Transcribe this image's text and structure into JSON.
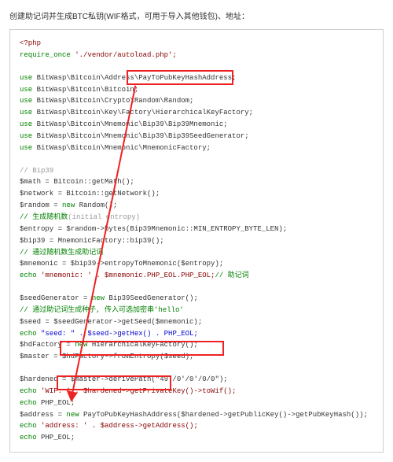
{
  "heading": "创建助记词并生成BTC私钥(WIF格式，可用于导入其他钱包)、地址：",
  "code": {
    "l1": "<?php",
    "l2a": "require_once",
    "l2b": " './vendor/autoload.php';",
    "l3a": "use",
    "l3b": " BitWasp\\Bitcoin\\Address",
    "l3c": "\\PayToPubKeyHashAddress;",
    "l4a": "use",
    "l4b": " BitWasp\\Bitcoin\\Bitcoin;",
    "l5a": "use",
    "l5b": " BitWasp\\Bitcoin\\Crypto\\Random\\Random;",
    "l6a": "use",
    "l6b": " BitWasp\\Bitcoin\\Key\\Factory\\HierarchicalKeyFactory;",
    "l7a": "use",
    "l7b": " BitWasp\\Bitcoin\\Mnemonic\\Bip39\\Bip39Mnemonic;",
    "l8a": "use",
    "l8b": " BitWasp\\Bitcoin\\Mnemonic\\Bip39\\Bip39SeedGenerator;",
    "l9a": "use",
    "l9b": " BitWasp\\Bitcoin\\Mnemonic\\MnemonicFactory;",
    "c0": "// Bip39",
    "l10": "$math = Bitcoin::getMath();",
    "l11": "$network = Bitcoin::getNetwork();",
    "l12a": "$random = ",
    "l12b": "new",
    "l12c": " Random();",
    "c1a": "// 生成随机数",
    "c1b": "(initial entropy)",
    "l13": "$entropy = $random->bytes(Bip39Mnemonic::MIN_ENTROPY_BYTE_LEN);",
    "l14": "$bip39 = MnemonicFactory::bip39();",
    "c2": "// 通过随机数生成助记词",
    "l15": "$mnemonic = $bip39->entropyToMnemonic($entropy);",
    "l16a": "echo",
    "l16b": " 'mnemonic: ' . $mnemonic.PHP_EOL.PHP_EOL;",
    "l16c": "// 助记词",
    "l17a": "$seedGenerator = ",
    "l17b": "new",
    "l17c": " Bip39SeedGenerator();",
    "c3": "// 通过助记词生成种子, 传入可选加密串'hello'",
    "l18": "$seed = $seedGenerator->getSeed($mnemonic);",
    "l19a": "echo",
    "l19b": " \"seed: \" . $seed->getHex() . PHP_EOL;",
    "l20a": "$hdFactory = ",
    "l20b": "new",
    "l20c": " HierarchicalKeyFactory();",
    "l21": "$master = $hdFactory->fromEntropy($seed);",
    "l22a": "$hardened = ",
    "l22b": "$master->derivePath(\"49'/0'/0'/0/0\");",
    "l23a": "echo",
    "l23b": " 'WIF: ' . $hardened->getPrivateKey()->toWif();",
    "l24a": "echo",
    "l24b": " PHP_EOL;",
    "l25a": "$address = ",
    "l25b": "new",
    "l25c": " PayToPubKeyHashAddress",
    "l25d": "($hardened->getPublicKey()->getPubKeyHash());",
    "l26a": "echo",
    "l26b": " 'address: ' . $address->getAddress();",
    "l27a": "echo",
    "l27b": " PHP_EOL;"
  }
}
